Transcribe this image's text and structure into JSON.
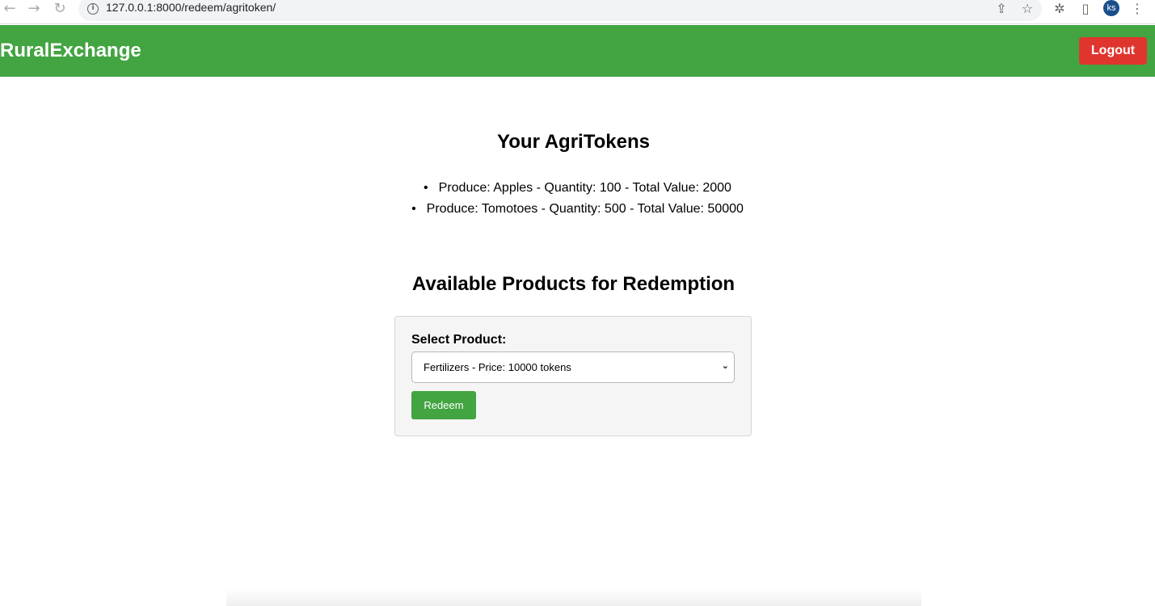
{
  "browser": {
    "url": "127.0.0.1:8000/redeem/agritoken/",
    "profile_initials": "ks",
    "icons": [
      "back-icon",
      "forward-icon",
      "reload-icon",
      "info-icon",
      "share-icon",
      "star-icon",
      "extensions-icon",
      "sidepanel-icon",
      "menu-icon"
    ]
  },
  "navbar": {
    "brand": "RuralExchange",
    "logout_label": "Logout",
    "color": "#43a442",
    "logout_color": "#e0352f"
  },
  "tokens": {
    "title": "Your AgriTokens",
    "items": [
      "Produce: Apples - Quantity: 100 - Total Value: 2000",
      "Produce: Tomotoes - Quantity: 500 - Total Value: 50000"
    ]
  },
  "redemption": {
    "title": "Available Products for Redemption",
    "select_label": "Select Product:",
    "selected_product": "Fertilizers - Price: 10000 tokens",
    "redeem_label": "Redeem"
  }
}
